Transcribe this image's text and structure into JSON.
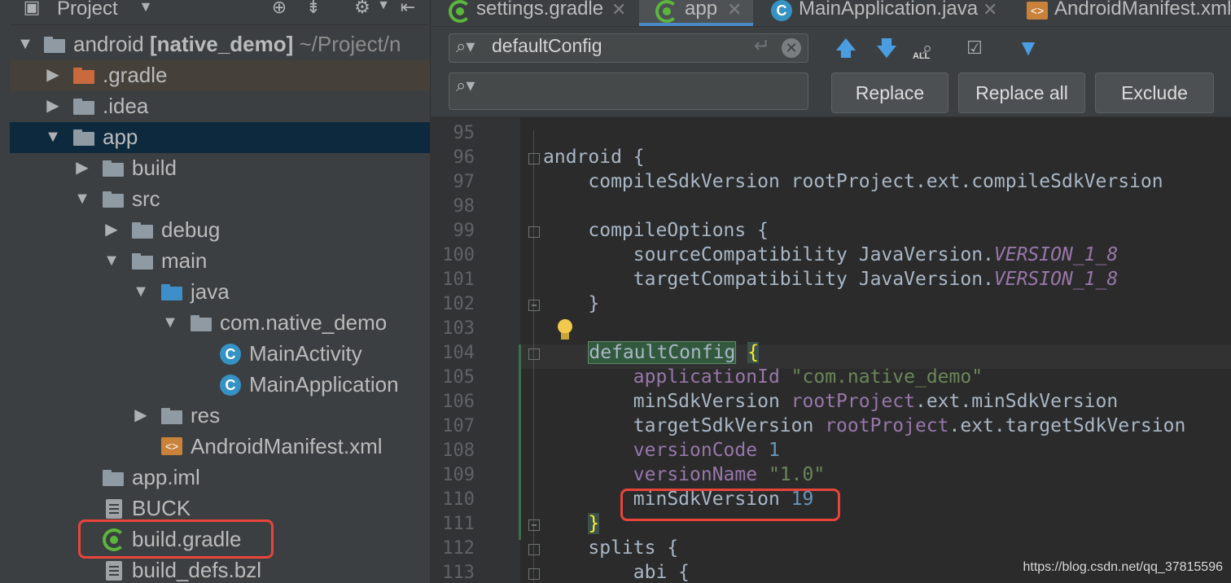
{
  "project_panel": {
    "title": "Project",
    "tree": [
      {
        "label": "android",
        "bold": "[native_demo]",
        "path": "~/Project/n"
      },
      {
        "label": ".gradle"
      },
      {
        "label": ".idea"
      },
      {
        "label": "app"
      },
      {
        "label": "build"
      },
      {
        "label": "src"
      },
      {
        "label": "debug"
      },
      {
        "label": "main"
      },
      {
        "label": "java"
      },
      {
        "label": "com.native_demo"
      },
      {
        "label": "MainActivity"
      },
      {
        "label": "MainApplication"
      },
      {
        "label": "res"
      },
      {
        "label": "AndroidManifest.xml"
      },
      {
        "label": "app.iml"
      },
      {
        "label": "BUCK"
      },
      {
        "label": "build.gradle"
      },
      {
        "label": "build_defs.bzl"
      }
    ]
  },
  "tabs": [
    {
      "label": "settings.gradle"
    },
    {
      "label": "app"
    },
    {
      "label": "MainApplication.java"
    },
    {
      "label": "AndroidManifest.xml"
    }
  ],
  "find": {
    "search_value": "defaultConfig",
    "replace_value": "",
    "replace_label": "Replace",
    "replace_all_label": "Replace all",
    "exclude_label": "Exclude",
    "all_badge": "ALL"
  },
  "code": {
    "line_numbers": [
      "95",
      "96",
      "97",
      "98",
      "99",
      "100",
      "101",
      "102",
      "103",
      "104",
      "105",
      "106",
      "107",
      "108",
      "109",
      "110",
      "111",
      "112",
      "113"
    ]
  },
  "watermark": "https://blog.csdn.net/qq_37815596",
  "colors": {
    "accent": "#4a88c7",
    "highlight_box": "#e8443a",
    "selection": "#0d293e"
  }
}
